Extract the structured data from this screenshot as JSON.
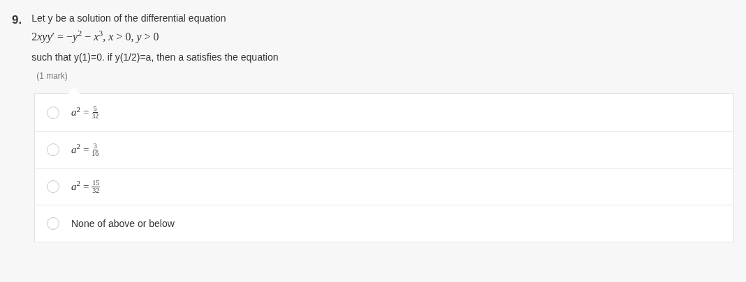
{
  "question": {
    "number": "9.",
    "prompt": "Let y be a solution of the differential equation",
    "coefficient": "2",
    "equation": "*xyy*′ = −*y*$^{2}$ − *x*$^{3}$, *x* > 0, *y* > 0",
    "condition": "such that y(1)=0. if y(1/2)=a, then a satisfies the equation",
    "marks": "(1 mark)"
  },
  "options": [
    {
      "kind": "fraction",
      "lhs": "*a*$^{2}$ =",
      "numerator": "5",
      "denominator": "32",
      "selected": false
    },
    {
      "kind": "fraction",
      "lhs": "*a*$^{2}$ =",
      "numerator": "3",
      "denominator": "16",
      "selected": false
    },
    {
      "kind": "fraction",
      "lhs": "*a*$^{2}$ =",
      "numerator": "15",
      "denominator": "32",
      "selected": false
    },
    {
      "kind": "text",
      "label": "None of above or below",
      "selected": false
    }
  ]
}
